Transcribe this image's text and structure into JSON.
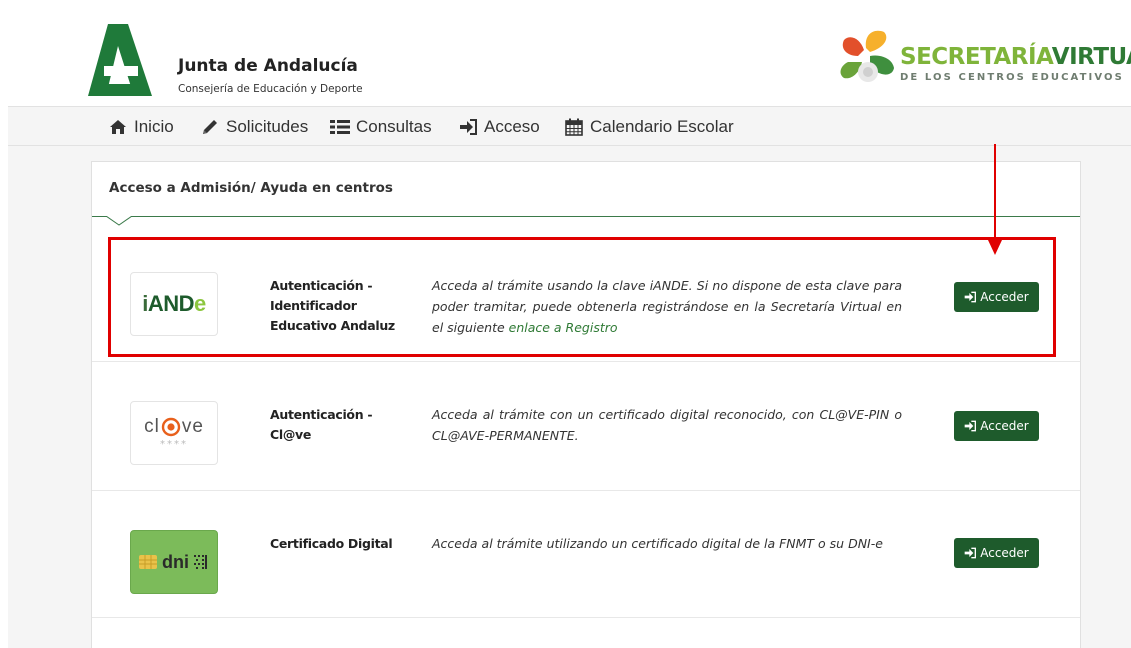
{
  "header": {
    "org_name": "Junta de Andalucía",
    "org_subtitle": "Consejería de Educación y Deporte",
    "portal_title_part1": "SECRETARÍA",
    "portal_title_part2": "VIRTUAL",
    "portal_subtitle": "DE LOS CENTROS EDUCATIVOS"
  },
  "nav": {
    "items": [
      {
        "label": "Inicio",
        "icon": "home-icon"
      },
      {
        "label": "Solicitudes",
        "icon": "pencil-icon"
      },
      {
        "label": "Consultas",
        "icon": "list-icon"
      },
      {
        "label": "Acceso",
        "icon": "sign-in-icon"
      },
      {
        "label": "Calendario Escolar",
        "icon": "calendar-icon"
      }
    ]
  },
  "panel": {
    "title": "Acceso a Admisión/ Ayuda en centros",
    "methods": [
      {
        "logo_text": "iANDe",
        "name": "Autenticación - Identificador Educativo Andaluz",
        "description": "Acceda al trámite usando la clave iANDE. Si no dispone de esta clave para poder tramitar, puede obtenerla registrándose en la Secretaría Virtual en el siguiente",
        "link_text": "enlace a Registro",
        "button_label": "Acceder"
      },
      {
        "logo_text_left": "cl",
        "logo_text_right": "ve",
        "logo_stars": "****",
        "name": "Autenticación - Cl@ve",
        "description": "Acceda al trámite con un certificado digital reconocido, con CL@VE-PIN o CL@AVE-PERMANENTE.",
        "button_label": "Acceder"
      },
      {
        "logo_text": "dni",
        "name": "Certificado Digital",
        "description": "Acceda al trámite utilizando un certificado digital de la FNMT o su DNI-e",
        "button_label": "Acceder"
      }
    ]
  },
  "colors": {
    "primary_green": "#1e5b2c",
    "link_green": "#2f7a35",
    "highlight_red": "#e00000"
  }
}
